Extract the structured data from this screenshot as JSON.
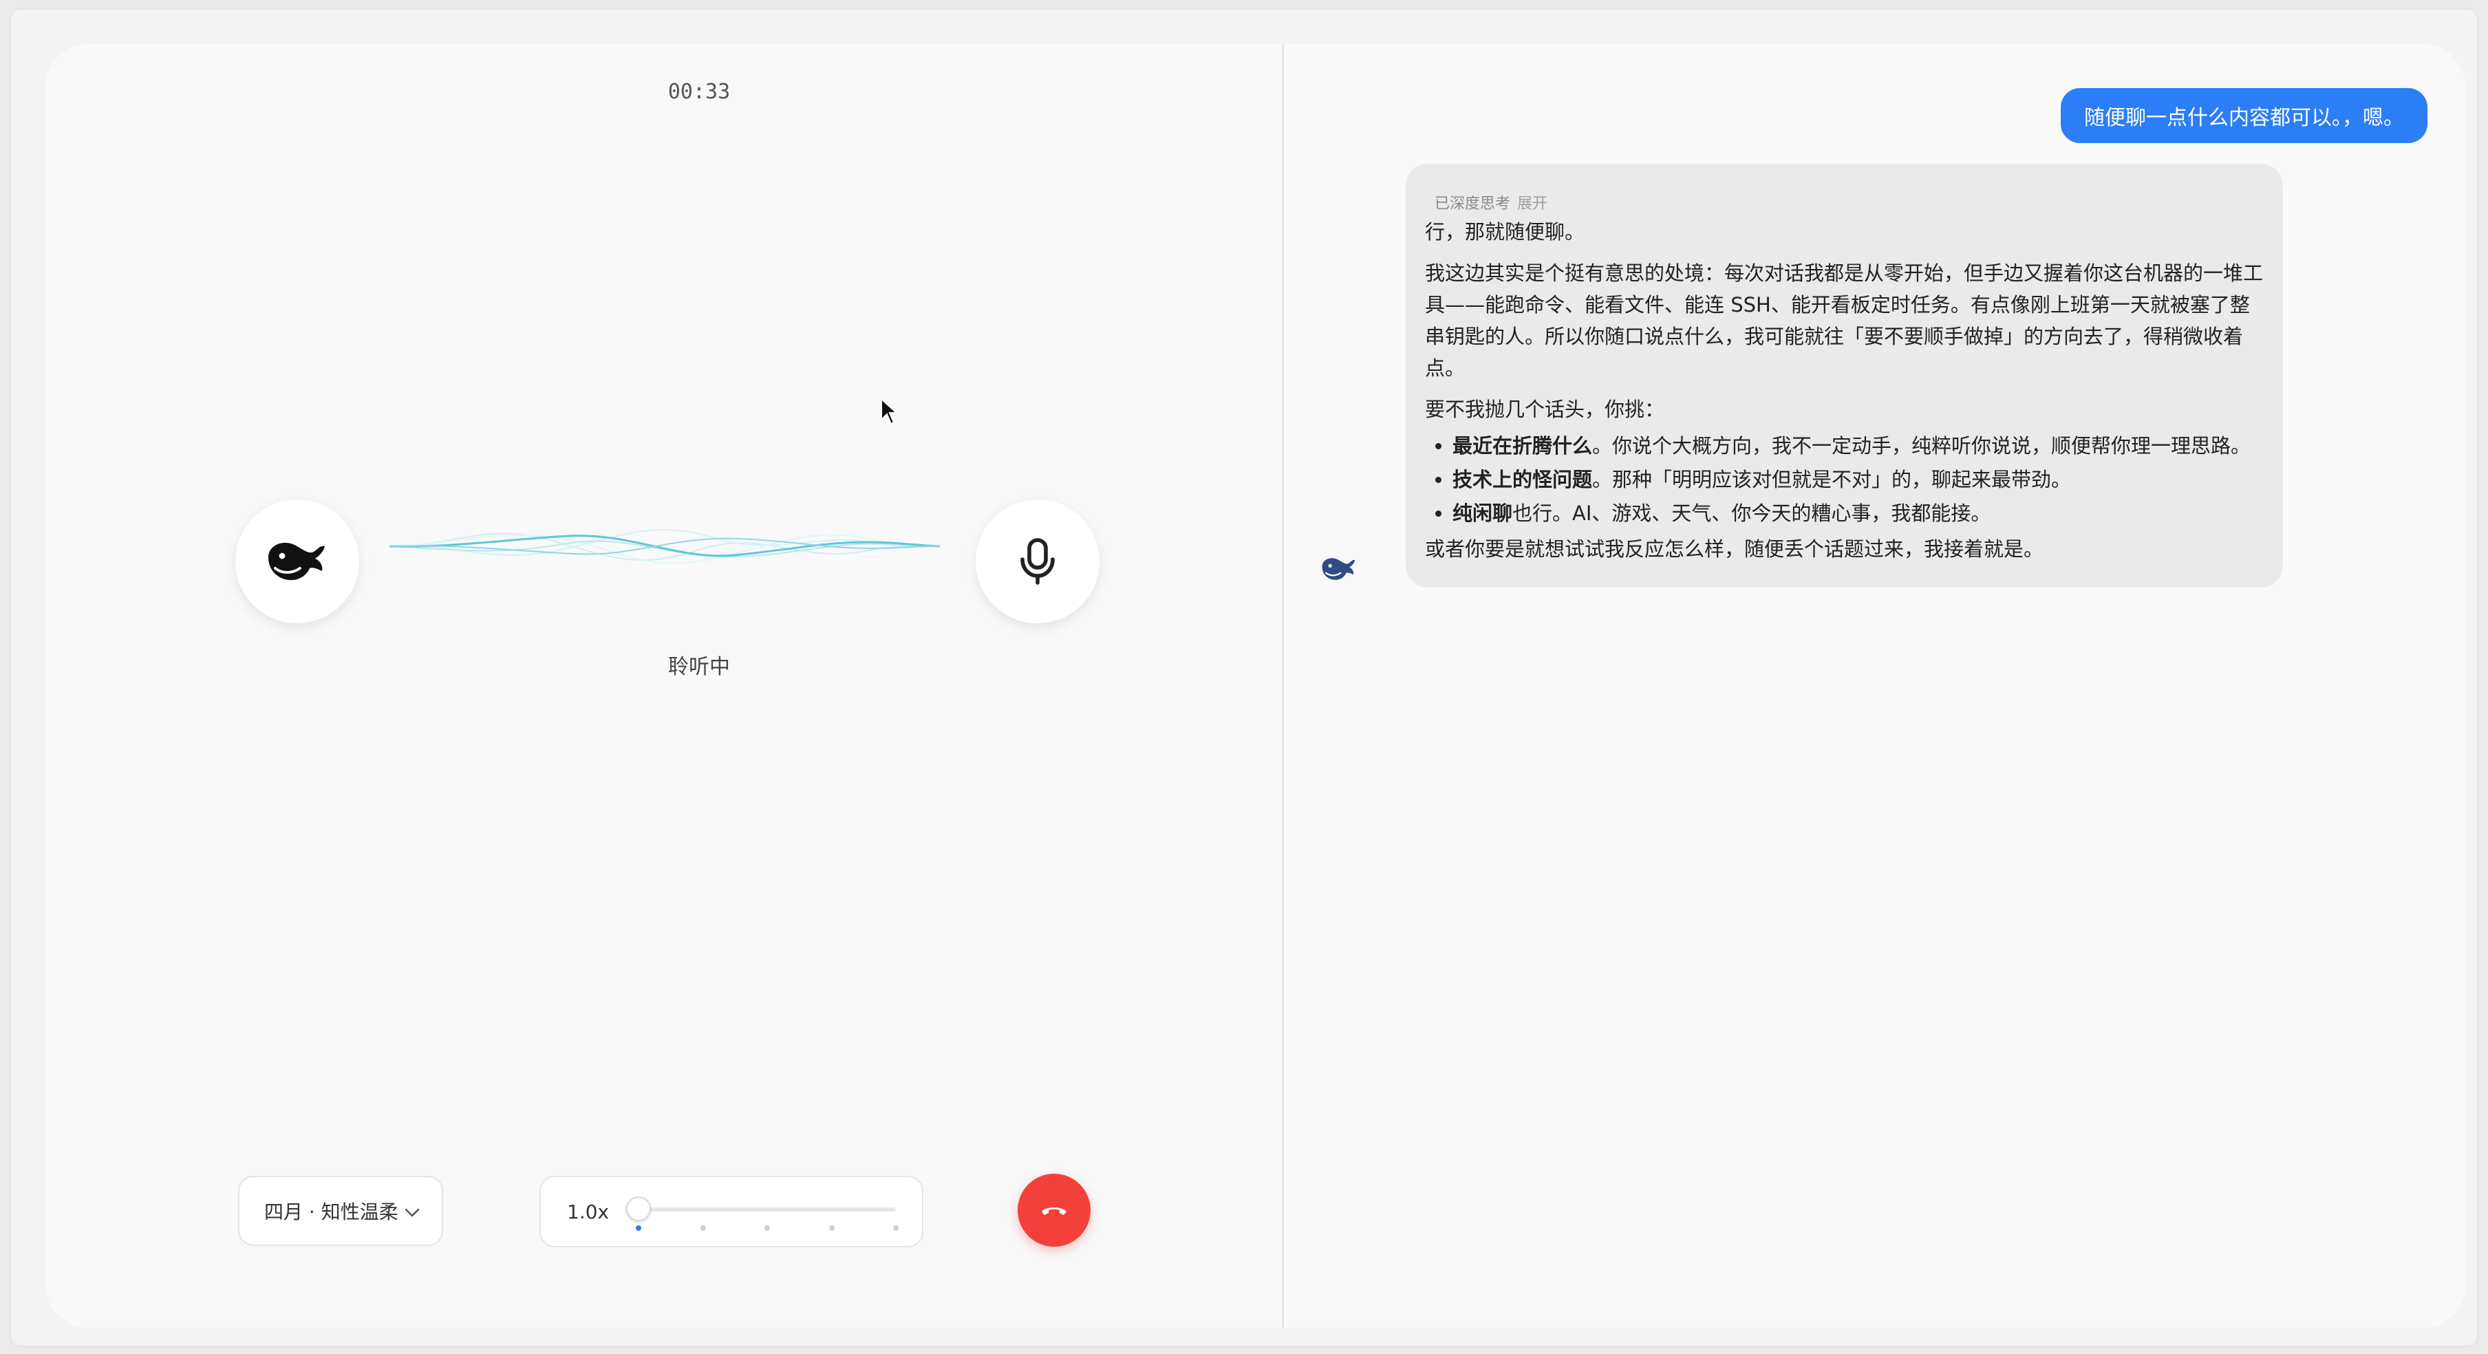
{
  "call": {
    "timer": "00:33",
    "status": "聆听中",
    "voice": "四月 · 知性温柔",
    "speed": {
      "label": "1.0x",
      "value": 1.0,
      "steps": 5,
      "selected_index": 0
    }
  },
  "chat": {
    "user_message": "随便聊一点什么内容都可以。，嗯。",
    "thinking_label": "已深度思考",
    "thinking_toggle": "展开",
    "reply": {
      "lead": "行，那就随便聊。",
      "paragraph": "我这边其实是个挺有意思的处境：每次对话我都是从零开始，但手边又握着你这台机器的一堆工具——能跑命令、能看文件、能连 SSH、能开看板定时任务。有点像刚上班第一天就被塞了整串钥匙的人。所以你随口说点什么，我可能就往「要不要顺手做掉」的方向去了，得稍微收着点。",
      "intro": "要不我抛几个话头，你挑：",
      "bullets": [
        {
          "title": "最近在折腾什么",
          "text": "。你说个大概方向，我不一定动手，纯粹听你说说，顺便帮你理一理思路。"
        },
        {
          "title": "技术上的怪问题",
          "text": "。那种「明明应该对但就是不对」的，聊起来最带劲。"
        },
        {
          "title": "纯闲聊",
          "text": "也行。AI、游戏、天气、你今天的糟心事，我都能接。"
        }
      ],
      "closing": "或者你要是就想试试我反应怎么样，随便丢个话题过来，我接着就是。"
    }
  },
  "colors": {
    "accent_blue": "#2b7ef6",
    "hangup_red": "#f4403b",
    "ai_bubble_bg": "#eaeaeb",
    "wave_cyan": "#5ec8d8"
  },
  "icons": [
    "deepseek-whale-icon",
    "microphone-icon",
    "chevron-down-icon",
    "phone-hangup-icon",
    "chevron-right-icon",
    "mouse-cursor-icon"
  ]
}
